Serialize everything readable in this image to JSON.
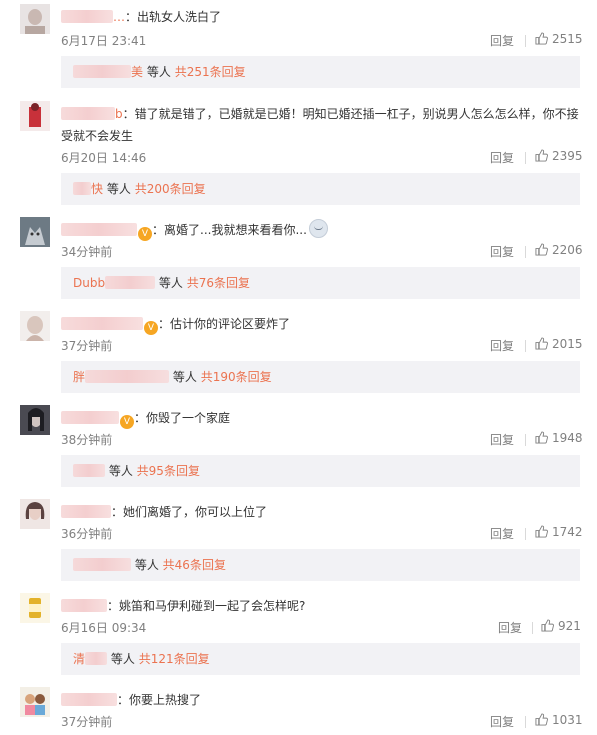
{
  "comments": [
    {
      "username": "…",
      "content": "：出轨女人洗白了",
      "time": "6月17日 23:41",
      "reply_label": "回复",
      "likes": "2515",
      "sub": {
        "users_suffix": "等人",
        "total": "共251条回复",
        "name_tail": "美"
      }
    },
    {
      "username": "b",
      "content": "：错了就是错了，已婚就是已婚！明知已婚还插一杠子，别说男人怎么怎么样，你不接受就不会发生",
      "time": "6月20日 14:46",
      "reply_label": "回复",
      "likes": "2395",
      "sub": {
        "users_suffix": "等人",
        "total": "共200条回复",
        "name_tail": "快"
      }
    },
    {
      "username": "",
      "content": "：离婚了...我就想来看看你...",
      "time": "34分钟前",
      "reply_label": "回复",
      "likes": "2206",
      "sub": {
        "users_suffix": "等人",
        "total": "共76条回复",
        "name_tail": "Dubb"
      }
    },
    {
      "username": "",
      "content": "：估计你的评论区要炸了",
      "time": "37分钟前",
      "reply_label": "回复",
      "likes": "2015",
      "sub": {
        "users_suffix": "等人",
        "total": "共190条回复",
        "name_tail": "胖"
      }
    },
    {
      "username": "",
      "content": "：你毁了一个家庭",
      "time": "38分钟前",
      "reply_label": "回复",
      "likes": "1948",
      "sub": {
        "users_suffix": "等人",
        "total": "共95条回复",
        "name_tail": ""
      }
    },
    {
      "username": "",
      "content": "：她们离婚了，你可以上位了",
      "time": "36分钟前",
      "reply_label": "回复",
      "likes": "1742",
      "sub": {
        "users_suffix": "等人",
        "total": "共46条回复",
        "name_tail": ""
      }
    },
    {
      "username": "",
      "content": "：姚笛和马伊利碰到一起了会怎样呢?",
      "time": "6月16日 09:34",
      "reply_label": "回复",
      "likes": "921",
      "sub": {
        "users_suffix": "等人",
        "total": "共121条回复",
        "name_tail": "清"
      }
    },
    {
      "username": "",
      "content": "：你要上热搜了",
      "time": "37分钟前",
      "reply_label": "回复",
      "likes": "1031",
      "sub": null
    }
  ],
  "icons": {
    "like": "thumbs-up-icon",
    "vip": "vip-badge-icon"
  },
  "colors": {
    "accent": "#eb7350",
    "meta": "#808080",
    "sub_bg": "#f2f2f5"
  }
}
